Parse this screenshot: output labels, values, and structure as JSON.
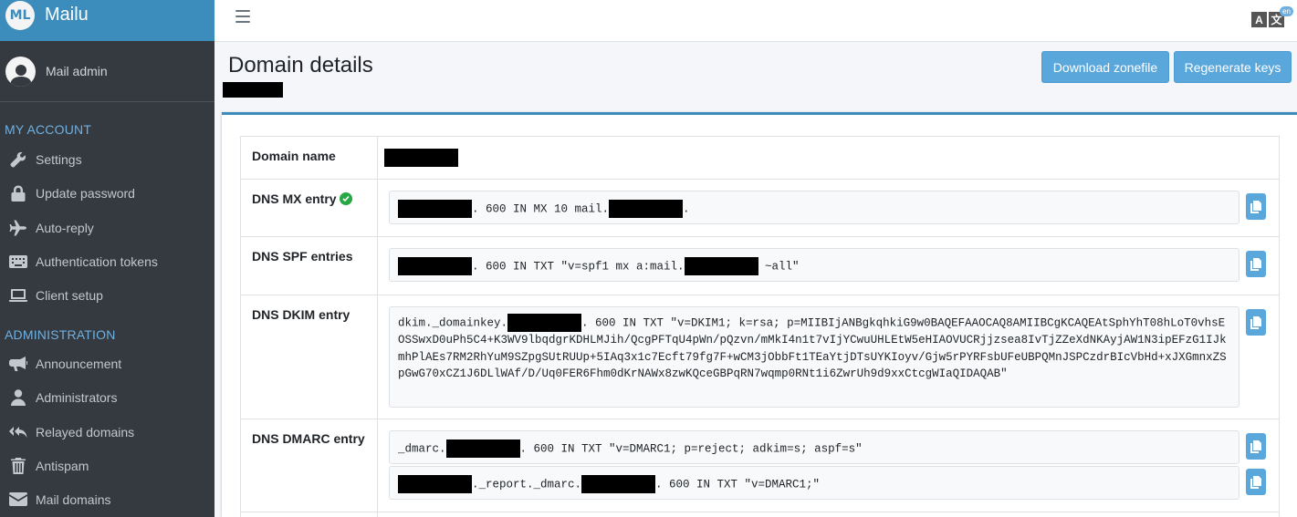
{
  "brand": {
    "logo_text": "ML",
    "name": "Mailu"
  },
  "user": {
    "name": "Mail admin"
  },
  "sidebar": {
    "my_account_header": "MY ACCOUNT",
    "my_account_items": [
      {
        "label": "Settings",
        "icon": "wrench-icon"
      },
      {
        "label": "Update password",
        "icon": "lock-icon"
      },
      {
        "label": "Auto-reply",
        "icon": "plane-icon"
      },
      {
        "label": "Authentication tokens",
        "icon": "keyboard-icon"
      },
      {
        "label": "Client setup",
        "icon": "laptop-icon"
      }
    ],
    "admin_header": "ADMINISTRATION",
    "admin_items": [
      {
        "label": "Announcement",
        "icon": "bullhorn-icon"
      },
      {
        "label": "Administrators",
        "icon": "user-icon"
      },
      {
        "label": "Relayed domains",
        "icon": "reply-all-icon"
      },
      {
        "label": "Antispam",
        "icon": "trash-icon"
      },
      {
        "label": "Mail domains",
        "icon": "envelope-icon"
      }
    ]
  },
  "topbar": {
    "lang_a": "A",
    "lang_b": "文",
    "lang_badge": "en"
  },
  "page": {
    "title": "Domain details",
    "download_label": "Download zonefile",
    "regenerate_label": "Regenerate keys"
  },
  "details": {
    "domain_name_label": "Domain name",
    "mx_label": "DNS MX entry",
    "mx_value_mid": ". 600 IN MX 10 mail.",
    "mx_value_end": ".",
    "spf_label": "DNS SPF entries",
    "spf_value_mid": ". 600 IN TXT \"v=spf1 mx a:mail.",
    "spf_value_end": " ~all\"",
    "dkim_label": "DNS DKIM entry",
    "dkim_value_start": "dkim._domainkey.",
    "dkim_value_rest": ". 600 IN TXT \"v=DKIM1; k=rsa; p=MIIBIjANBgkqhkiG9w0BAQEFAAOCAQ8AMIIBCgKCAQEAtSphYhT08hLoT0vhsEOSSwxD0uPh5C4+K3WV9lbqdgrKDHLMJih/QcgPFTqU4pWn/pQzvn/mMkI4n1t7vIjYCwuUHLEtW5eHIAOVUCRjjzsea8IvTjZZeXdNKAyjAW1N3ipEFzG1IJkmhPlAEs7RM2RhYuM9SZpgSUtRUUp+5IAq3x1c7Ecft79fg7F+wCM3jObbFt1TEaYtjDTsUYKIoyv/Gjw5rPYRFsbUFeUBPQMnJSPCzdrBIcVbHd+xJXGmnxZSpGwG70xCZ1J6DLlWAf/D/Uq0FER6Fhm0dKrNAWx8zwKQceGBPqRN7wqmp0RNt1i6ZwrUh9d9xxCtcgWIaQIDAQAB\"",
    "dmarc_label": "DNS DMARC entry",
    "dmarc_value_start": "_dmarc.",
    "dmarc_value_end": ". 600 IN TXT \"v=DMARC1; p=reject; adkim=s; aspf=s\"",
    "dmarc_report_mid": "._report._dmarc.",
    "dmarc_report_end": ". 600 IN TXT \"v=DMARC1;\""
  },
  "colors": {
    "brand": "#3c8dbc",
    "sidebar": "#343a40",
    "accent_button": "#5aa7dc",
    "check": "#28a745"
  }
}
